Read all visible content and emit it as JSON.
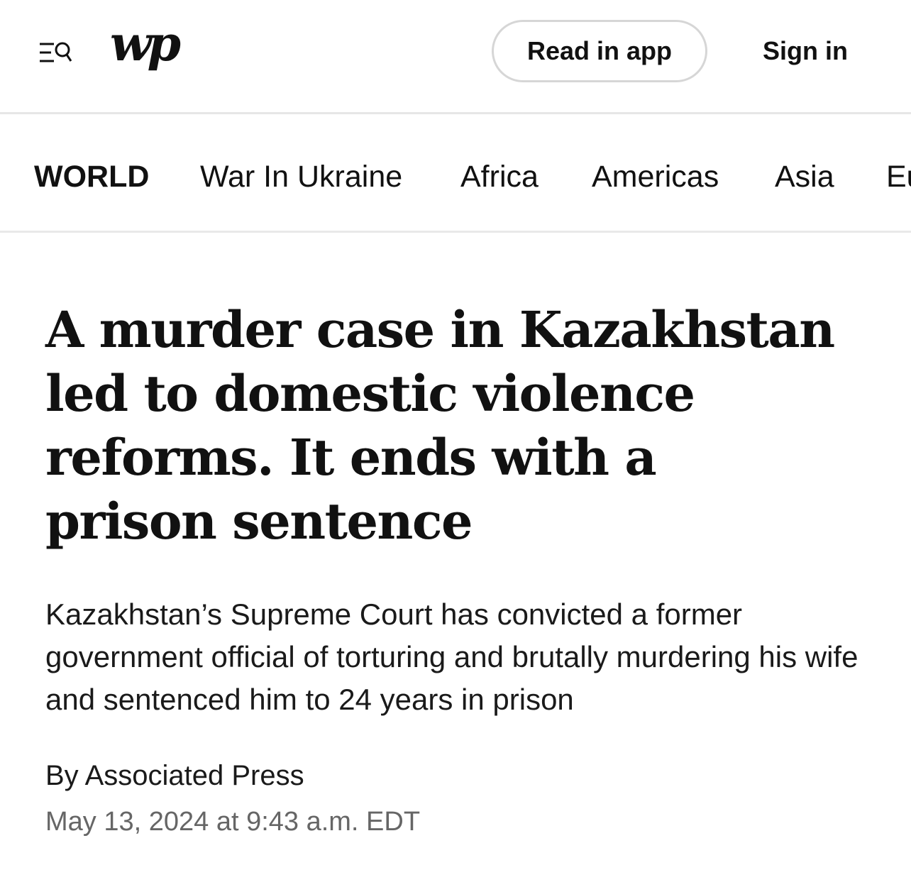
{
  "header": {
    "menu_icon": "menu-search-icon",
    "logo_text": "wp",
    "read_in_app_label": "Read in app",
    "sign_in_label": "Sign in"
  },
  "section_nav": {
    "items": [
      {
        "label": "WORLD",
        "active": true
      },
      {
        "label": "War In Ukraine"
      },
      {
        "label": "Africa"
      },
      {
        "label": "Americas"
      },
      {
        "label": "Asia"
      },
      {
        "label": "Eu"
      }
    ]
  },
  "article": {
    "headline": "A murder case in Kazakhstan led to domestic violence reforms. It ends with a prison sentence",
    "dek": "Kazakhstan’s Supreme Court has convicted a former government official of torturing and brutally murdering his wife and sentenced him to 24 years in prison",
    "byline_prefix": "By",
    "author": "Associated Press",
    "timestamp": "May 13, 2024 at 9:43 a.m. EDT"
  },
  "colors": {
    "text": "#111111",
    "muted": "#666666",
    "divider": "#e6e6e6",
    "button_border": "#d6d6d6"
  }
}
